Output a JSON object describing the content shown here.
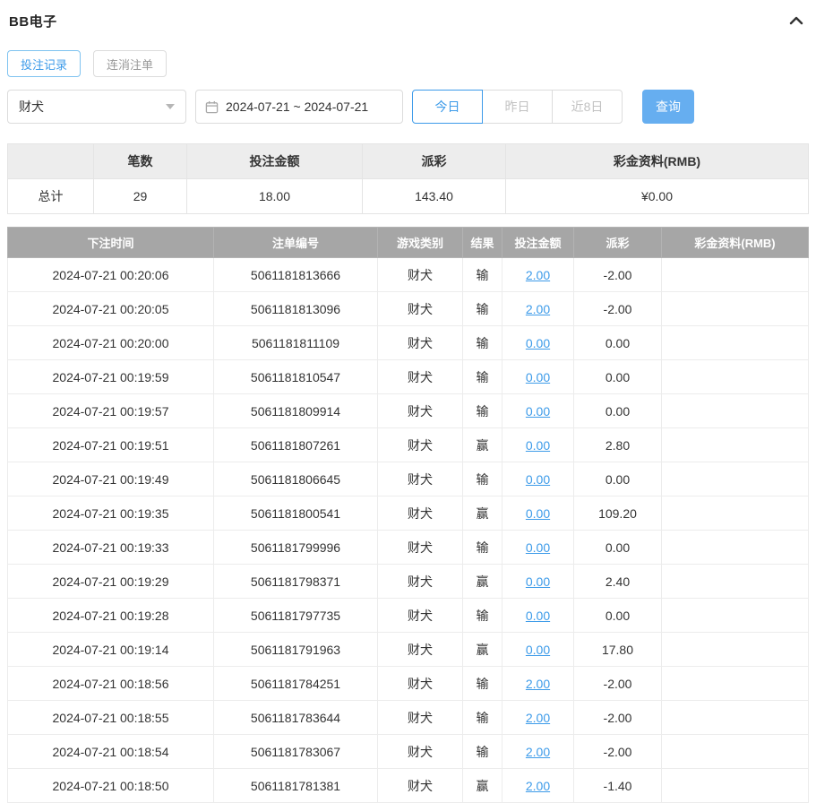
{
  "header": {
    "title": "BB电子",
    "collapse_icon": "chevron-up"
  },
  "tabs": {
    "bet_records": "投注记录",
    "cancelled_orders": "连消注单"
  },
  "filters": {
    "game_select": {
      "value": "财犬",
      "icon": "chevron-down-icon"
    },
    "date_range": {
      "value": "2024-07-21 ~ 2024-07-21",
      "icon": "calendar-icon"
    },
    "quick": {
      "today": "今日",
      "yesterday": "昨日",
      "last8days": "近8日"
    },
    "query_label": "查询"
  },
  "summary": {
    "headers": [
      "",
      "笔数",
      "投注金额",
      "派彩",
      "彩金资料(RMB)"
    ],
    "total_label": "总计",
    "count": "29",
    "bet_amount": "18.00",
    "payout": "143.40",
    "bonus": "¥0.00"
  },
  "records": {
    "headers": [
      "下注时间",
      "注单编号",
      "游戏类别",
      "结果",
      "投注金额",
      "派彩",
      "彩金资料(RMB)"
    ],
    "rows": [
      {
        "time": "2024-07-21 00:20:06",
        "order": "5061181813666",
        "game": "财犬",
        "result": "输",
        "bet": "2.00",
        "payout": "-2.00",
        "bonus": ""
      },
      {
        "time": "2024-07-21 00:20:05",
        "order": "5061181813096",
        "game": "财犬",
        "result": "输",
        "bet": "2.00",
        "payout": "-2.00",
        "bonus": ""
      },
      {
        "time": "2024-07-21 00:20:00",
        "order": "5061181811109",
        "game": "财犬",
        "result": "输",
        "bet": "0.00",
        "payout": "0.00",
        "bonus": ""
      },
      {
        "time": "2024-07-21 00:19:59",
        "order": "5061181810547",
        "game": "财犬",
        "result": "输",
        "bet": "0.00",
        "payout": "0.00",
        "bonus": ""
      },
      {
        "time": "2024-07-21 00:19:57",
        "order": "5061181809914",
        "game": "财犬",
        "result": "输",
        "bet": "0.00",
        "payout": "0.00",
        "bonus": ""
      },
      {
        "time": "2024-07-21 00:19:51",
        "order": "5061181807261",
        "game": "财犬",
        "result": "赢",
        "bet": "0.00",
        "payout": "2.80",
        "bonus": ""
      },
      {
        "time": "2024-07-21 00:19:49",
        "order": "5061181806645",
        "game": "财犬",
        "result": "输",
        "bet": "0.00",
        "payout": "0.00",
        "bonus": ""
      },
      {
        "time": "2024-07-21 00:19:35",
        "order": "5061181800541",
        "game": "财犬",
        "result": "赢",
        "bet": "0.00",
        "payout": "109.20",
        "bonus": ""
      },
      {
        "time": "2024-07-21 00:19:33",
        "order": "5061181799996",
        "game": "财犬",
        "result": "输",
        "bet": "0.00",
        "payout": "0.00",
        "bonus": ""
      },
      {
        "time": "2024-07-21 00:19:29",
        "order": "5061181798371",
        "game": "财犬",
        "result": "赢",
        "bet": "0.00",
        "payout": "2.40",
        "bonus": ""
      },
      {
        "time": "2024-07-21 00:19:28",
        "order": "5061181797735",
        "game": "财犬",
        "result": "输",
        "bet": "0.00",
        "payout": "0.00",
        "bonus": ""
      },
      {
        "time": "2024-07-21 00:19:14",
        "order": "5061181791963",
        "game": "财犬",
        "result": "赢",
        "bet": "0.00",
        "payout": "17.80",
        "bonus": ""
      },
      {
        "time": "2024-07-21 00:18:56",
        "order": "5061181784251",
        "game": "财犬",
        "result": "输",
        "bet": "2.00",
        "payout": "-2.00",
        "bonus": ""
      },
      {
        "time": "2024-07-21 00:18:55",
        "order": "5061181783644",
        "game": "财犬",
        "result": "输",
        "bet": "2.00",
        "payout": "-2.00",
        "bonus": ""
      },
      {
        "time": "2024-07-21 00:18:54",
        "order": "5061181783067",
        "game": "财犬",
        "result": "输",
        "bet": "2.00",
        "payout": "-2.00",
        "bonus": ""
      },
      {
        "time": "2024-07-21 00:18:50",
        "order": "5061181781381",
        "game": "财犬",
        "result": "赢",
        "bet": "2.00",
        "payout": "-1.40",
        "bonus": ""
      }
    ]
  },
  "colors": {
    "accent_blue": "#3d9be9",
    "query_button_bg": "#66aef0",
    "table_header_bg": "#a6a6a6",
    "negative_red": "#e05b5b"
  }
}
